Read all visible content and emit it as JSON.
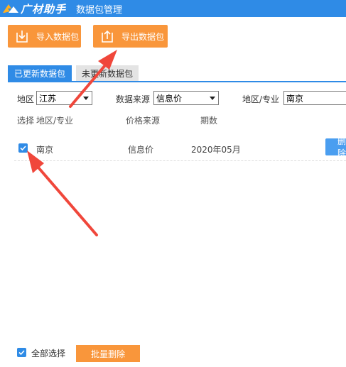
{
  "app": {
    "logo_text": "广材助手",
    "window_title": "数据包管理"
  },
  "toolbar": {
    "import_label": "导入数据包",
    "export_label": "导出数据包"
  },
  "tabs": [
    {
      "label": "已更新数据包",
      "active": true
    },
    {
      "label": "未更新数据包",
      "active": false
    }
  ],
  "filters": {
    "region_label": "地区",
    "region_value": "江苏",
    "source_label": "数据来源",
    "source_value": "信息价",
    "area_label": "地区/专业",
    "area_value": "南京"
  },
  "table": {
    "headers": [
      "选择",
      "地区/专业",
      "价格来源",
      "期数"
    ],
    "rows": [
      {
        "checked": true,
        "area": "南京",
        "source": "信息价",
        "period": "2020年05月",
        "action": "删除"
      }
    ]
  },
  "footer": {
    "select_all_label": "全部选择",
    "select_all_checked": true,
    "batch_delete_label": "批量删除"
  },
  "colors": {
    "primary": "#2f8be6",
    "accent_orange": "#f9963b",
    "annotation_red": "#f0473b"
  },
  "icons": {
    "import": "download-tray-icon",
    "export": "upload-tray-icon",
    "check": "check-icon"
  }
}
